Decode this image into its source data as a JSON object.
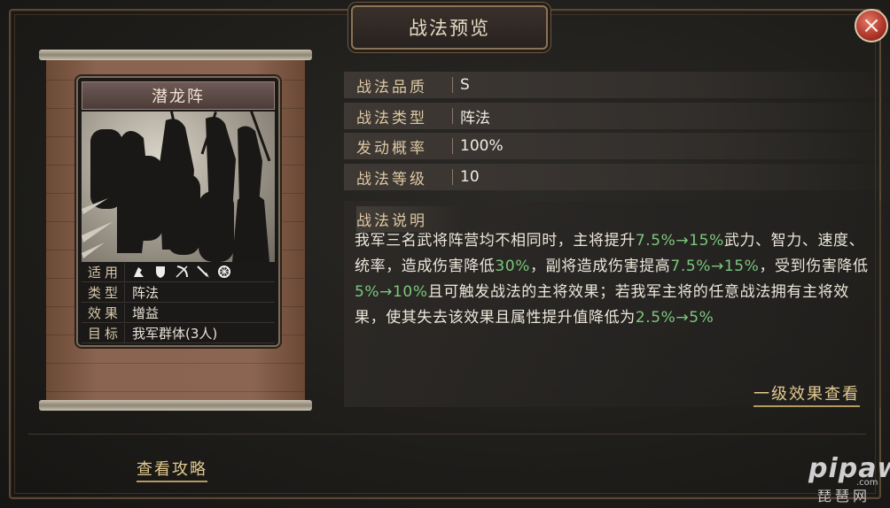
{
  "window": {
    "title": "战法预览",
    "close_label": "×"
  },
  "card": {
    "name": "潜龙阵",
    "rows": [
      {
        "key": "适用",
        "value": ""
      },
      {
        "key": "类型",
        "value": "阵法"
      },
      {
        "key": "效果",
        "value": "增益"
      },
      {
        "key": "目标",
        "value": "我军群体(3人)"
      }
    ],
    "unit_icons": [
      "cavalry-icon",
      "shield-icon",
      "bow-icon",
      "spear-icon",
      "siege-wheel-icon"
    ]
  },
  "attributes": [
    {
      "key": "战法品质",
      "value": "S"
    },
    {
      "key": "战法类型",
      "value": "阵法"
    },
    {
      "key": "发动概率",
      "value": "100%"
    },
    {
      "key": "战法等级",
      "value": "10"
    }
  ],
  "description": {
    "title": "战法说明",
    "segments": [
      {
        "text": "我军三名武将阵营均不相同时，主将提升",
        "hl": false
      },
      {
        "text": "7.5%→15%",
        "hl": true
      },
      {
        "text": "武力、智力、速度、统率，造成伤害降低",
        "hl": false
      },
      {
        "text": "30%",
        "hl": true
      },
      {
        "text": "，副将造成伤害提高",
        "hl": false
      },
      {
        "text": "7.5%→15%",
        "hl": true
      },
      {
        "text": "，受到伤害降低",
        "hl": false
      },
      {
        "text": "5%→10%",
        "hl": true
      },
      {
        "text": "且可触发战法的主将效果；若我军主将的任意战法拥有主将效果，使其失去该效果且属性提升值降低为",
        "hl": false
      },
      {
        "text": "2.5%→5%",
        "hl": true
      }
    ],
    "highlight_color": "#7cc77d"
  },
  "links": {
    "level_effects": "一级效果查看",
    "strategy_guide": "查看攻略"
  },
  "watermark": {
    "brand": "pipaw",
    "domain": ".com",
    "cn": "琵琶网"
  }
}
